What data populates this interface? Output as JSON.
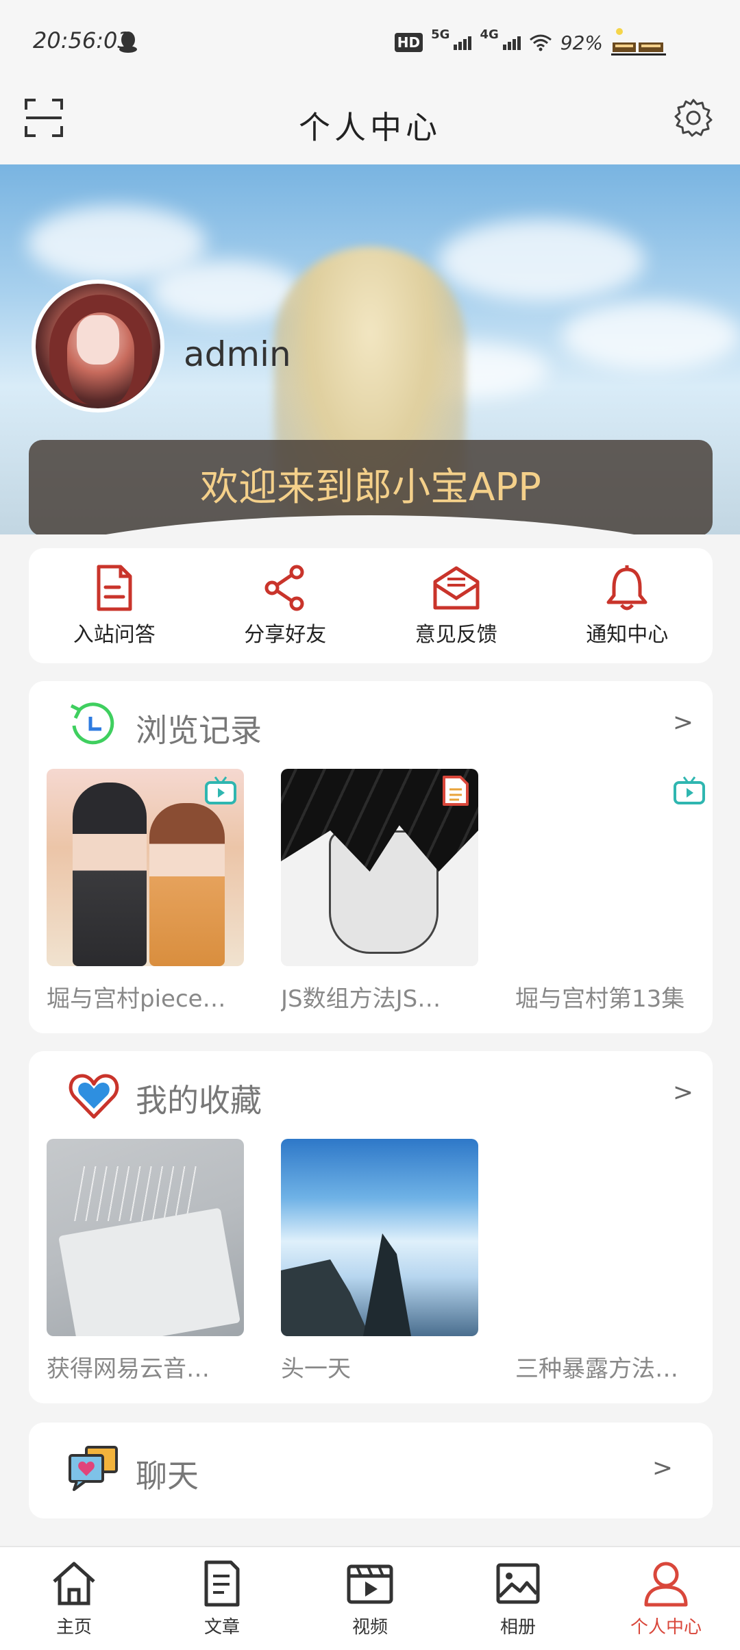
{
  "status_bar": {
    "time": "20:56:03",
    "hd": "HD",
    "net1": "5G",
    "net2": "4G",
    "battery": "92%"
  },
  "header": {
    "title": "个人中心"
  },
  "profile": {
    "username": "admin",
    "welcome": "欢迎来到郎小宝APP"
  },
  "quick_actions": [
    {
      "label": "入站问答",
      "icon": "document-icon"
    },
    {
      "label": "分享好友",
      "icon": "share-icon"
    },
    {
      "label": "意见反馈",
      "icon": "mail-icon"
    },
    {
      "label": "通知中心",
      "icon": "bell-icon"
    }
  ],
  "history": {
    "title": "浏览记录",
    "more": ">",
    "items": [
      {
        "caption": "堀与宫村piece…",
        "badge": "video"
      },
      {
        "caption": "JS数组方法JS…",
        "badge": "article"
      },
      {
        "caption": "堀与宫村第13集",
        "badge": "video"
      }
    ]
  },
  "favorites": {
    "title": "我的收藏",
    "more": ">",
    "items": [
      {
        "caption": "获得网易云音…"
      },
      {
        "caption": "头一天"
      },
      {
        "caption": "三种暴露方法…"
      }
    ]
  },
  "chat": {
    "title": "聊天",
    "more": ">"
  },
  "tabs": [
    {
      "label": "主页",
      "icon": "home-icon"
    },
    {
      "label": "文章",
      "icon": "article-icon"
    },
    {
      "label": "视频",
      "icon": "video-icon"
    },
    {
      "label": "相册",
      "icon": "image-icon"
    },
    {
      "label": "个人中心",
      "icon": "user-icon",
      "active": true
    }
  ],
  "colors": {
    "accent_red": "#d9473b",
    "welcome_text": "#f4d08a",
    "badge_teal": "#2fb6b0"
  }
}
